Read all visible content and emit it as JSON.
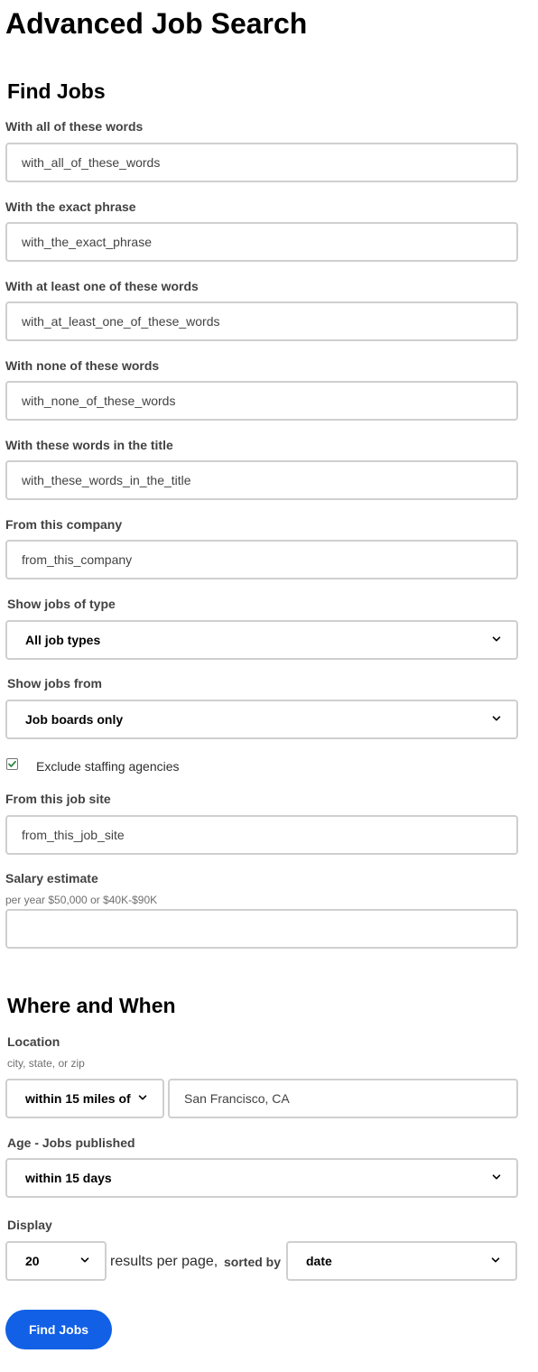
{
  "page": {
    "title": "Advanced Job Search"
  },
  "find_jobs": {
    "heading": "Find Jobs",
    "all_words": {
      "label": "With all of these words",
      "value": "with_all_of_these_words"
    },
    "exact_phrase": {
      "label": "With the exact phrase",
      "value": "with_the_exact_phrase"
    },
    "at_least_one": {
      "label": "With at least one of these words",
      "value": "with_at_least_one_of_these_words"
    },
    "none_words": {
      "label": "With none of these words",
      "value": "with_none_of_these_words"
    },
    "title_words": {
      "label": "With these words in the title",
      "value": "with_these_words_in_the_title"
    },
    "company": {
      "label": "From this company",
      "value": "from_this_company"
    },
    "job_type": {
      "label": "Show jobs of type",
      "selected": "All job types"
    },
    "jobs_from": {
      "label": "Show jobs from",
      "selected": "Job boards only"
    },
    "exclude_staffing": {
      "label": "Exclude staffing agencies",
      "checked": true
    },
    "job_site": {
      "label": "From this job site",
      "value": "from_this_job_site"
    },
    "salary": {
      "label": "Salary estimate",
      "hint": "per year $50,000 or $40K-$90K",
      "value": ""
    }
  },
  "where_when": {
    "heading": "Where and When",
    "location": {
      "label": "Location",
      "hint": "city, state, or zip",
      "radius": "within 15 miles of",
      "value": "San Francisco, CA"
    },
    "age": {
      "label": "Age - Jobs published",
      "selected": "within 15 days"
    },
    "display": {
      "label": "Display",
      "per_page": "20",
      "results_text": "results per page,",
      "sorted_by_text": "sorted by",
      "sort": "date"
    }
  },
  "actions": {
    "find_jobs_label": "Find Jobs"
  },
  "colors": {
    "primary_button": "#1160e6",
    "input_border": "#cfcfcf",
    "checkbox_check": "#2e8540"
  },
  "icons": {
    "dropdown": "chevron-down-icon",
    "checkbox": "check-icon"
  }
}
